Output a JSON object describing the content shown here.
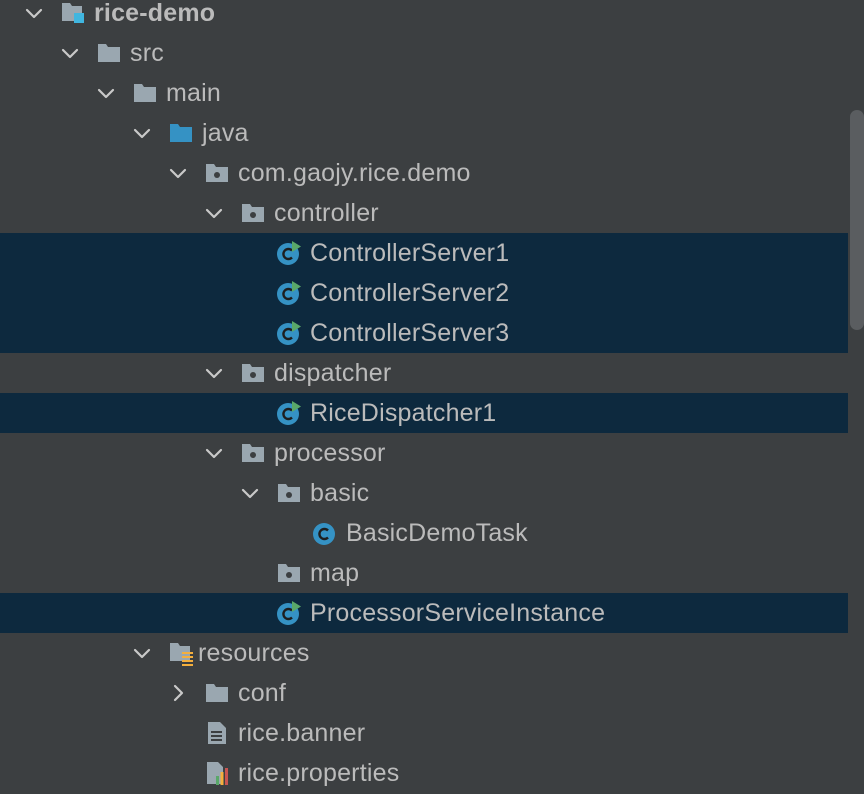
{
  "tree": {
    "root": {
      "label": "rice-demo",
      "icon": "module-folder-icon"
    },
    "src": {
      "label": "src",
      "icon": "folder-icon"
    },
    "main": {
      "label": "main",
      "icon": "folder-icon"
    },
    "java": {
      "label": "java",
      "icon": "source-root-folder-icon"
    },
    "pkg_demo": {
      "label": "com.gaojy.rice.demo",
      "icon": "package-icon"
    },
    "pkg_controller": {
      "label": "controller",
      "icon": "package-icon"
    },
    "cls_controller1": {
      "label": "ControllerServer1",
      "icon": "runnable-class-icon"
    },
    "cls_controller2": {
      "label": "ControllerServer2",
      "icon": "runnable-class-icon"
    },
    "cls_controller3": {
      "label": "ControllerServer3",
      "icon": "runnable-class-icon"
    },
    "pkg_dispatcher": {
      "label": "dispatcher",
      "icon": "package-icon"
    },
    "cls_dispatcher1": {
      "label": "RiceDispatcher1",
      "icon": "runnable-class-icon"
    },
    "pkg_processor": {
      "label": "processor",
      "icon": "package-icon"
    },
    "pkg_basic": {
      "label": "basic",
      "icon": "package-icon"
    },
    "cls_basic_task": {
      "label": "BasicDemoTask",
      "icon": "class-icon"
    },
    "pkg_map": {
      "label": "map",
      "icon": "package-icon"
    },
    "cls_processor_instance": {
      "label": "ProcessorServiceInstance",
      "icon": "runnable-class-icon"
    },
    "resources": {
      "label": "resources",
      "icon": "resources-folder-icon"
    },
    "conf": {
      "label": "conf",
      "icon": "folder-icon"
    },
    "rice_banner": {
      "label": "rice.banner",
      "icon": "text-file-icon"
    },
    "rice_properties": {
      "label": "rice.properties",
      "icon": "properties-file-icon"
    }
  },
  "colors": {
    "background": "#3c3f41",
    "selection": "#0d293e",
    "text": "#bbbbbb",
    "folder": "#9aa7b0",
    "source_folder": "#3592c4",
    "class_badge": "#3592c4",
    "run_arrow": "#59a869"
  }
}
